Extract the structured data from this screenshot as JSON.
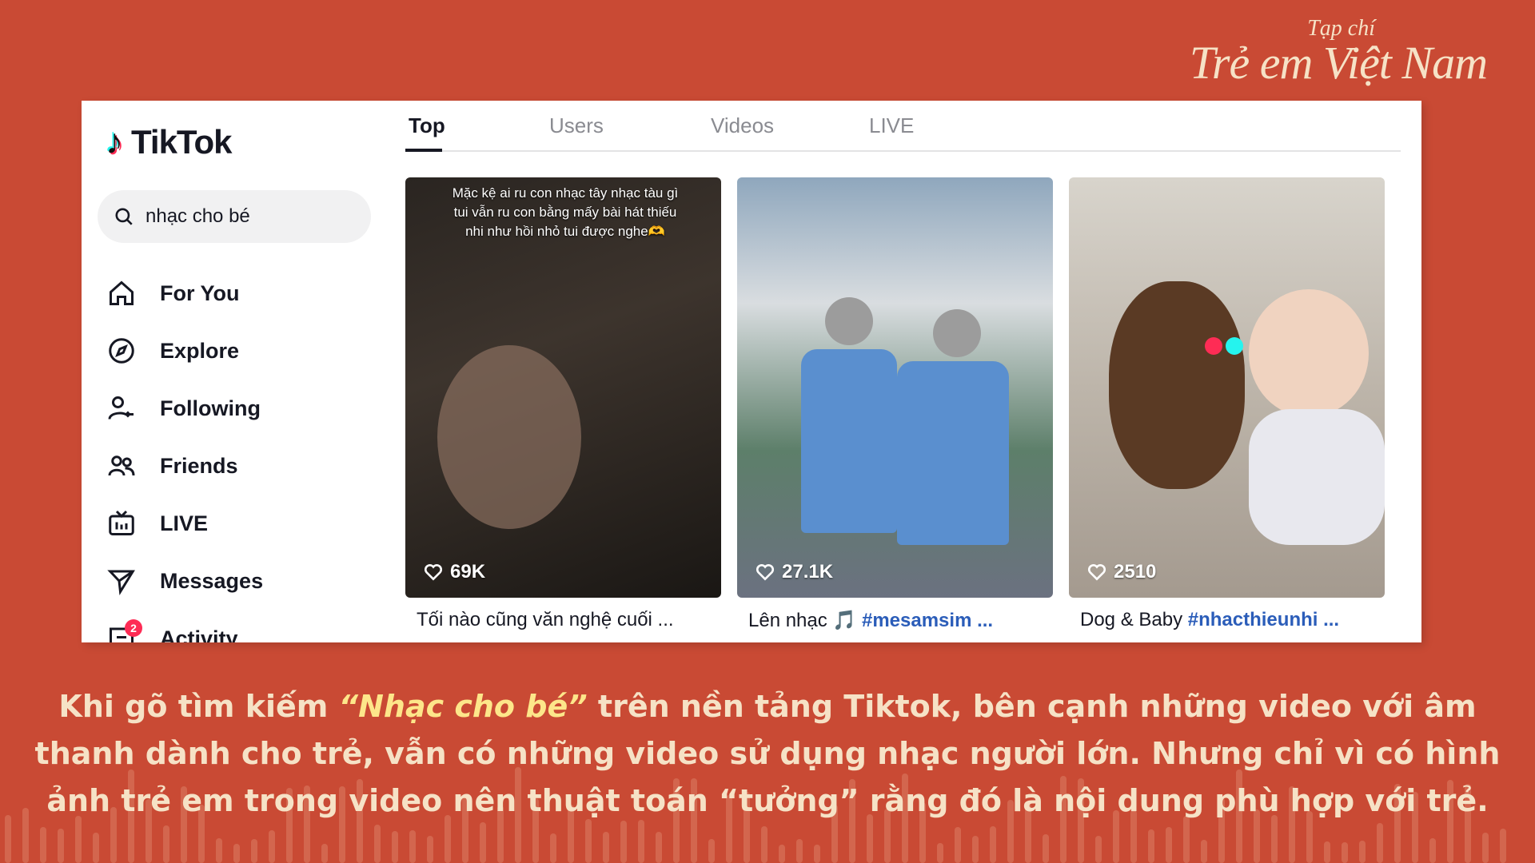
{
  "masthead": {
    "small": "Tạp chí",
    "big": "Trẻ em Việt Nam"
  },
  "app": {
    "logo_text": "TikTok"
  },
  "search": {
    "value": "nhạc cho bé"
  },
  "tabs": [
    {
      "label": "Top",
      "active": true
    },
    {
      "label": "Users",
      "active": false
    },
    {
      "label": "Videos",
      "active": false
    },
    {
      "label": "LIVE",
      "active": false
    }
  ],
  "nav": [
    {
      "label": "For You",
      "icon": "home-icon"
    },
    {
      "label": "Explore",
      "icon": "compass-icon"
    },
    {
      "label": "Following",
      "icon": "user-follow-icon"
    },
    {
      "label": "Friends",
      "icon": "friends-icon"
    },
    {
      "label": "LIVE",
      "icon": "live-tv-icon"
    },
    {
      "label": "Messages",
      "icon": "send-icon"
    },
    {
      "label": "Activity",
      "icon": "inbox-icon",
      "badge": "2"
    }
  ],
  "videos": [
    {
      "overlay_text": "Mặc kệ ai ru con nhạc tây nhạc tàu gì tui vẫn ru con bằng mấy bài hát thiếu nhi như hồi nhỏ tui được nghe🫶",
      "likes": "69K",
      "desc_text": "Tối nào cũng văn nghệ cuối ...",
      "desc_tag": ""
    },
    {
      "overlay_text": "",
      "likes": "27.1K",
      "desc_text": "Lên nhạc 🎵",
      "desc_tag": "#mesamsim ..."
    },
    {
      "overlay_text": "",
      "likes": "2510",
      "desc_text": "Dog & Baby",
      "desc_tag": "#nhacthieunhi ..."
    }
  ],
  "article": {
    "before": "Khi gõ tìm kiếm ",
    "highlight": "“Nhạc cho bé”",
    "after": " trên nền tảng Tiktok, bên cạnh những video với âm thanh dành cho trẻ, vẫn có những video sử dụng nhạc người lớn. Nhưng chỉ vì có hình ảnh trẻ em trong video nên thuật toán “tưởng” rằng đó là nội dung phù hợp với trẻ."
  },
  "colors": {
    "background": "#c94a34",
    "text": "#f6e2c6",
    "highlight": "#fde68a",
    "hashtag": "#2b5db9"
  }
}
